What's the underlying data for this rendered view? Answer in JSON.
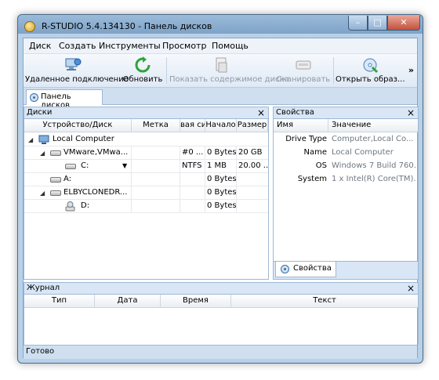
{
  "window": {
    "title": "R-STUDIO 5.4.134130 - Панель дисков"
  },
  "menu": [
    "Диск",
    "Создать",
    "Инструменты",
    "Просмотр",
    "Помощь"
  ],
  "toolbar": {
    "remote": "Удаленное подключение",
    "refresh": "Обновить",
    "show_contents": "Показать содержимое диска",
    "scan": "Сканировать",
    "open_image": "Открыть образ...",
    "more": "»"
  },
  "doc_tab": "Панель дисков",
  "disks_pane": {
    "title": "Диски",
    "close": "×",
    "columns": [
      "Устройство/Диск",
      "Метка",
      "вая си",
      "Начало",
      "Размер"
    ],
    "rows": [
      {
        "name": "Local Computer",
        "label": "",
        "fs": "",
        "start": "",
        "size": ""
      },
      {
        "name": "VMware,VMwa...",
        "label": "",
        "fs": "#0 ...",
        "start": "0 Bytes",
        "size": "20 GB"
      },
      {
        "name": "C:",
        "label": "",
        "fs": "NTFS",
        "start": "1 MB",
        "size": "20.00 ..."
      },
      {
        "name": "A:",
        "label": "",
        "fs": "",
        "start": "0 Bytes",
        "size": ""
      },
      {
        "name": "ELBYCLONEDR...",
        "label": "",
        "fs": "",
        "start": "0 Bytes",
        "size": ""
      },
      {
        "name": "D:",
        "label": "",
        "fs": "",
        "start": "0 Bytes",
        "size": ""
      }
    ]
  },
  "props_pane": {
    "title": "Свойства",
    "close": "×",
    "columns": [
      "Имя",
      "Значение"
    ],
    "rows": [
      {
        "name": "Drive Type",
        "value": "Computer,Local Co..."
      },
      {
        "name": "Name",
        "value": "Local Computer"
      },
      {
        "name": "OS",
        "value": "Windows 7 Build 760..."
      },
      {
        "name": "System",
        "value": "1 x Intel(R) Core(TM)..."
      }
    ],
    "tab": "Свойства"
  },
  "log_pane": {
    "title": "Журнал",
    "close": "×",
    "columns": [
      "Тип",
      "Дата",
      "Время",
      "Текст"
    ]
  },
  "status": "Готово"
}
